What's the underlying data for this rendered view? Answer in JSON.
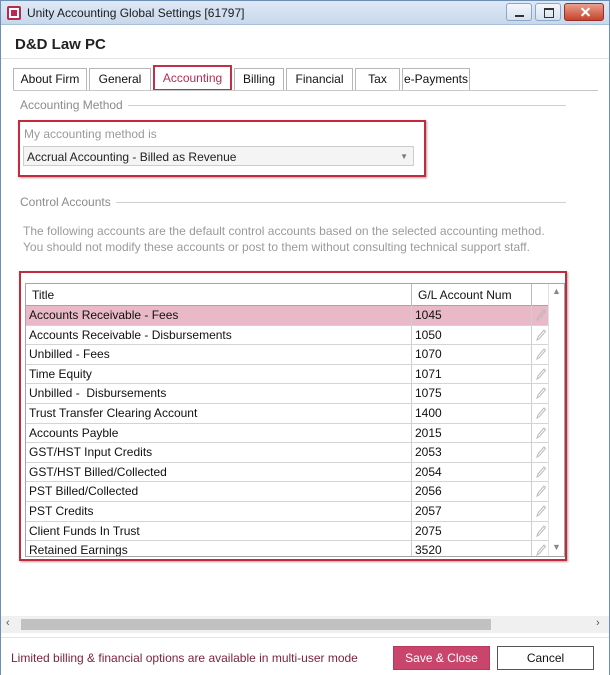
{
  "window": {
    "title": "Unity Accounting Global Settings [61797]"
  },
  "firm_name": "D&D Law PC",
  "tabs": [
    {
      "label": "About Firm",
      "active": false
    },
    {
      "label": "General",
      "active": false
    },
    {
      "label": "Accounting",
      "active": true
    },
    {
      "label": "Billing",
      "active": false
    },
    {
      "label": "Financial",
      "active": false
    },
    {
      "label": "Tax",
      "active": false
    },
    {
      "label": "e-Payments",
      "active": false
    }
  ],
  "accounting_method": {
    "section_title": "Accounting Method",
    "field_label": "My accounting method is",
    "selected_value": "Accrual Accounting - Billed as Revenue"
  },
  "control_accounts": {
    "section_title": "Control Accounts",
    "info_line1": "The following accounts are the default control accounts based on the selected accounting method.",
    "info_line2": "You should not modify these accounts or post to them without consulting technical support staff.",
    "columns": [
      "Title",
      "G/L Account Num"
    ],
    "rows": [
      {
        "title": "Accounts Receivable - Fees",
        "account": "1045",
        "selected": true
      },
      {
        "title": "Accounts Receivable - Disbursements",
        "account": "1050",
        "selected": false
      },
      {
        "title": "Unbilled - Fees",
        "account": "1070",
        "selected": false
      },
      {
        "title": "Time Equity",
        "account": "1071",
        "selected": false
      },
      {
        "title": "Unbilled -  Disbursements",
        "account": "1075",
        "selected": false
      },
      {
        "title": "Trust Transfer Clearing Account",
        "account": "1400",
        "selected": false
      },
      {
        "title": "Accounts Payble",
        "account": "2015",
        "selected": false
      },
      {
        "title": "GST/HST Input Credits",
        "account": "2053",
        "selected": false
      },
      {
        "title": "GST/HST Billed/Collected",
        "account": "2054",
        "selected": false
      },
      {
        "title": "PST Billed/Collected",
        "account": "2056",
        "selected": false
      },
      {
        "title": "PST Credits",
        "account": "2057",
        "selected": false
      },
      {
        "title": "Client Funds In Trust",
        "account": "2075",
        "selected": false
      },
      {
        "title": "Retained Earnings",
        "account": "3520",
        "selected": false
      }
    ]
  },
  "footer": {
    "message": "Limited billing & financial options are available in multi-user mode",
    "save_label": "Save & Close",
    "cancel_label": "Cancel"
  },
  "colors": {
    "accent": "#c9456c",
    "highlight_border": "#c22a3e",
    "selected_row": "#eab9c8"
  }
}
